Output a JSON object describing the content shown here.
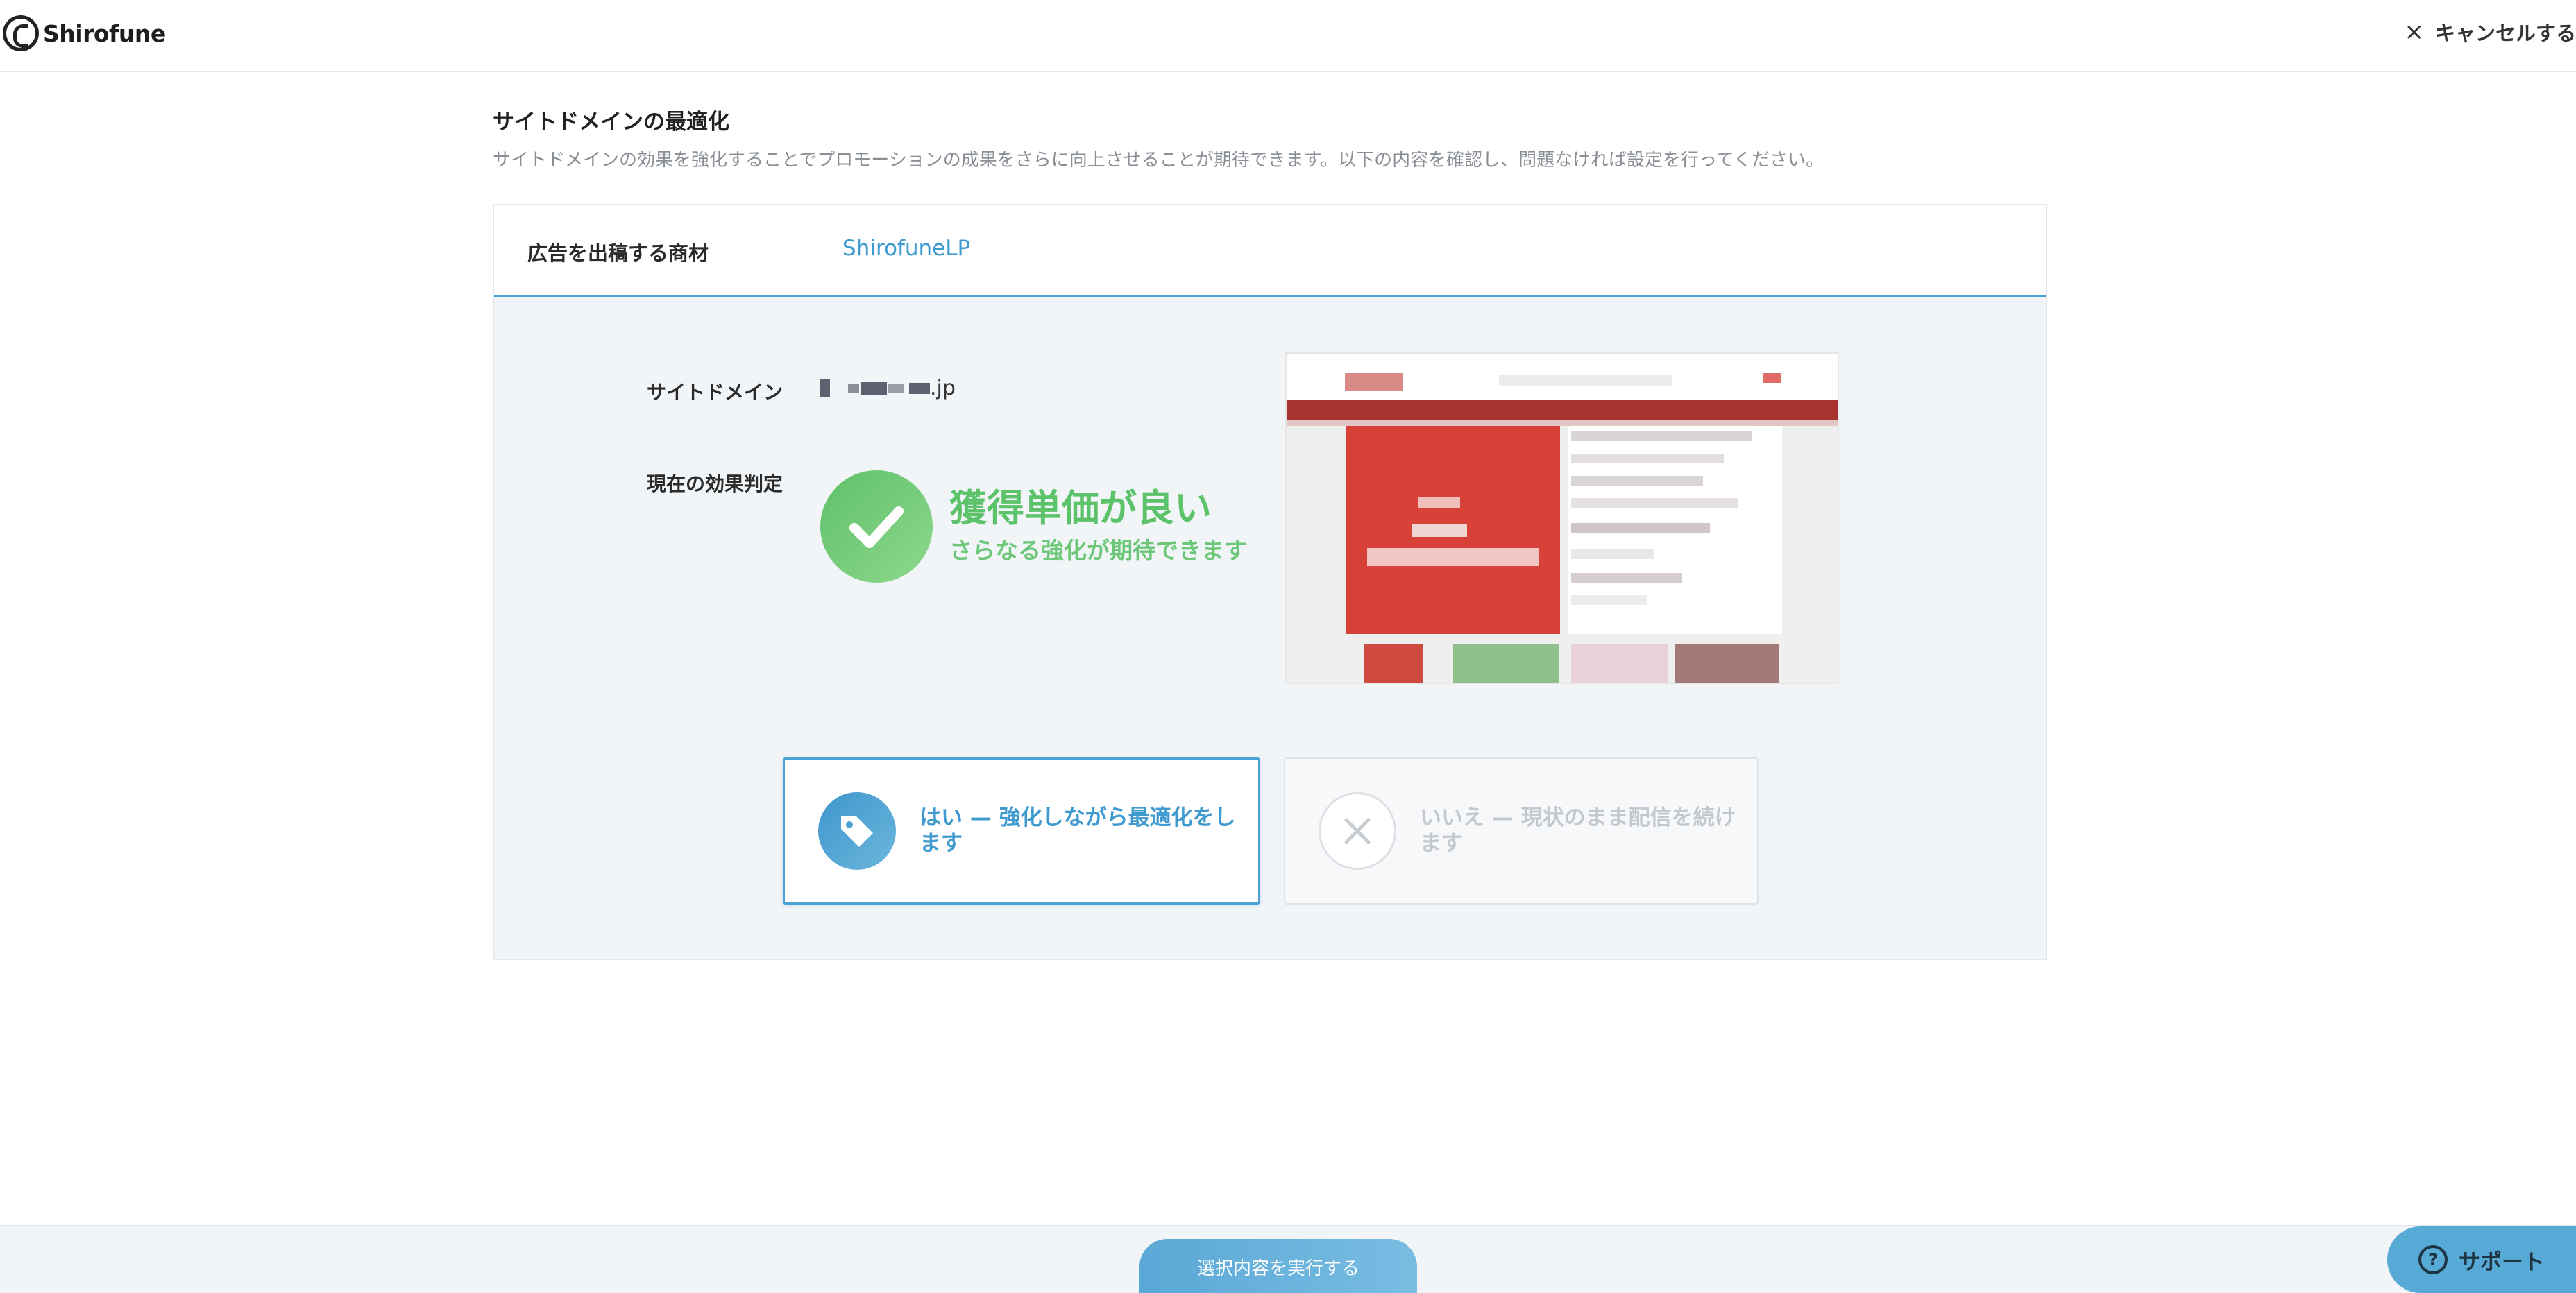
{
  "header": {
    "logo_text": "Shirofune",
    "cancel_label": "キャンセルする"
  },
  "page": {
    "title": "サイトドメインの最適化",
    "description": "サイトドメインの効果を強化することでプロモーションの成果をさらに向上させることが期待できます。以下の内容を確認し、問題なければ設定を行ってください。"
  },
  "card": {
    "product_label": "広告を出稿する商材",
    "product_value": "ShirofuneLP",
    "domain_label": "サイトドメイン",
    "domain_suffix": ".jp",
    "evaluation_label": "現在の効果判定",
    "evaluation_main": "獲得単価が良い",
    "evaluation_sub": "さらなる強化が期待できます",
    "evaluation_icon": "check-icon"
  },
  "choices": {
    "yes_label": "はい — 強化しながら最適化をします",
    "yes_icon": "tag-icon",
    "no_label": "いいえ — 現状のまま配信を続けます",
    "no_icon": "close-icon"
  },
  "footer": {
    "execute_label": "選択内容を実行する",
    "support_label": "サポート",
    "support_icon": "question-icon"
  },
  "colors": {
    "accent": "#4aa3d4",
    "success": "#5cc36a",
    "muted": "#c3c8ce"
  }
}
